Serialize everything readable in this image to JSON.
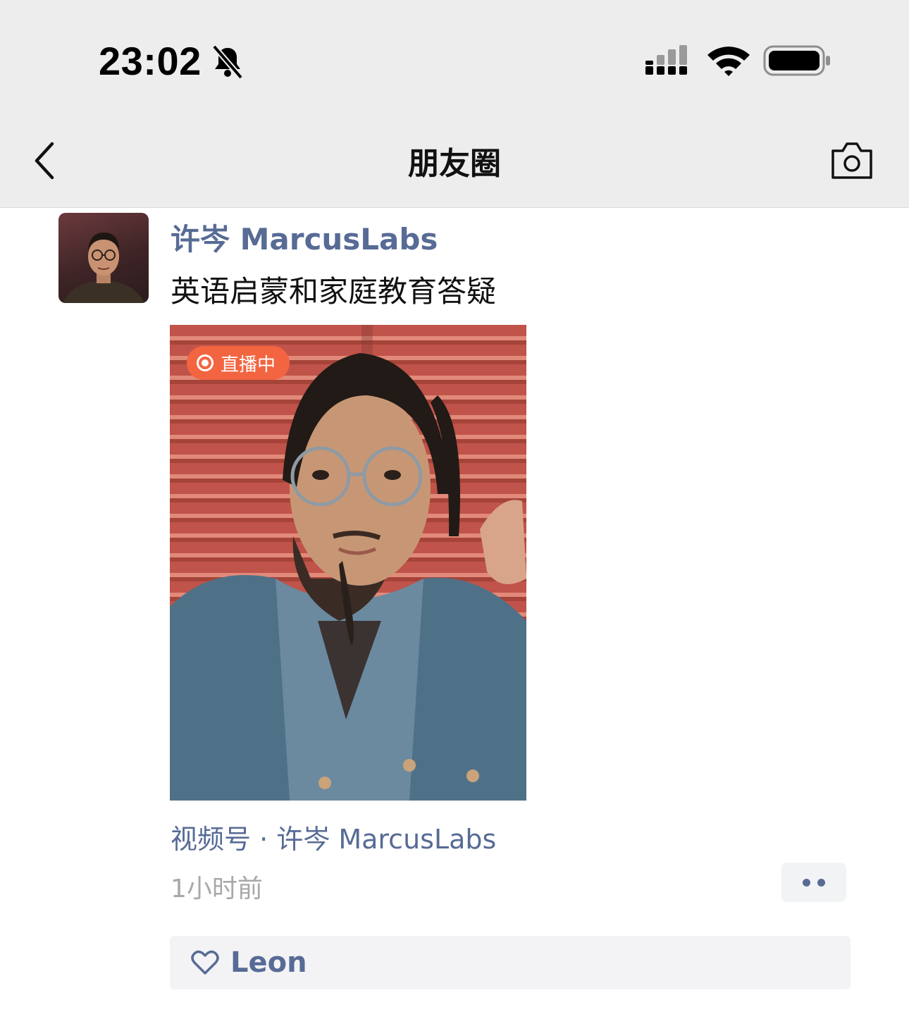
{
  "status_bar": {
    "time": "23:02"
  },
  "nav": {
    "title": "朋友圈",
    "back_icon": "chevron-left-icon",
    "camera_icon": "camera-icon"
  },
  "post": {
    "author": "许岑 MarcusLabs",
    "text": "英语启蒙和家庭教育答疑",
    "live_badge": "直播中",
    "channel": "视频号 · 许岑 MarcusLabs",
    "time": "1小时前",
    "likes": [
      "Leon"
    ]
  },
  "colors": {
    "link_blue": "#576b95",
    "live_badge": "#f26540",
    "nav_bg": "#ededed"
  }
}
